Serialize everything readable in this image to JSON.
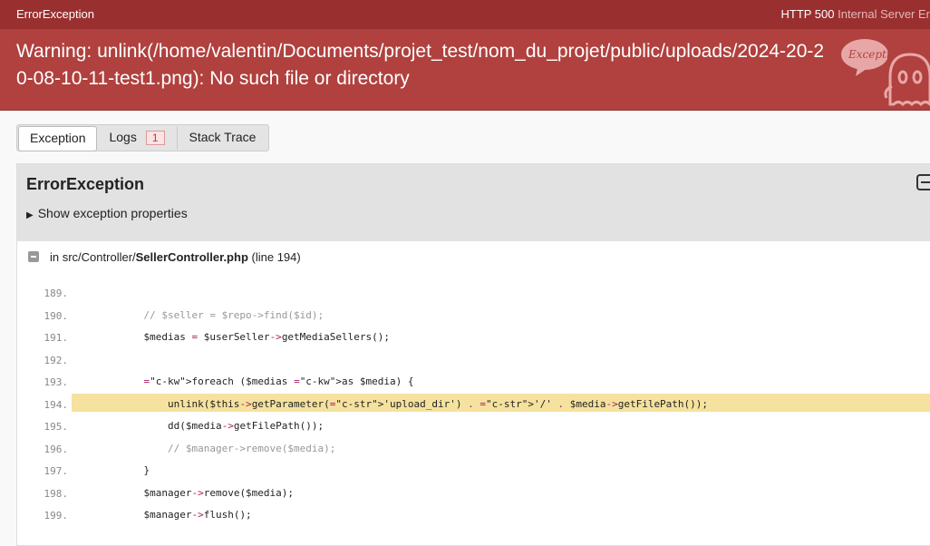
{
  "topbar": {
    "title": "ErrorException",
    "status_code": "HTTP 500",
    "status_text": "Internal Server Er"
  },
  "header": {
    "message": "Warning: unlink(/home/valentin/Documents/projet_test/nom_du_projet/public/uploads/2024-20-20-08-10-11-test1.png): No such file or directory",
    "ghost_text": "Exception!"
  },
  "tabs": [
    {
      "label": "Exception"
    },
    {
      "label": "Logs",
      "badge": "1"
    },
    {
      "label": "Stack Trace"
    }
  ],
  "panel": {
    "title": "ErrorException",
    "toggle_label": "Show exception properties",
    "file_prefix": "in src/Controller/",
    "file_name": "SellerController.php",
    "file_line": "(line 194)"
  },
  "code": [
    {
      "num": "189.",
      "text": ""
    },
    {
      "num": "190.",
      "text": "            // $seller = $repo->find($id);"
    },
    {
      "num": "191.",
      "text": "            $medias = $userSeller->getMediaSellers();"
    },
    {
      "num": "192.",
      "text": ""
    },
    {
      "num": "193.",
      "text": "            foreach ($medias as $media) {"
    },
    {
      "num": "194.",
      "text": "                unlink($this->getParameter('upload_dir') . '/' . $media->getFilePath());"
    },
    {
      "num": "195.",
      "text": "                dd($media->getFilePath());"
    },
    {
      "num": "196.",
      "text": "                // $manager->remove($media);"
    },
    {
      "num": "197.",
      "text": "            }"
    },
    {
      "num": "198.",
      "text": "            $manager->remove($media);"
    },
    {
      "num": "199.",
      "text": "            $manager->flush();"
    }
  ],
  "highlight_line": "194.",
  "colors": {
    "topbar": "#9a2f2f",
    "header": "#b0413e",
    "highlight": "#f5e29e"
  }
}
